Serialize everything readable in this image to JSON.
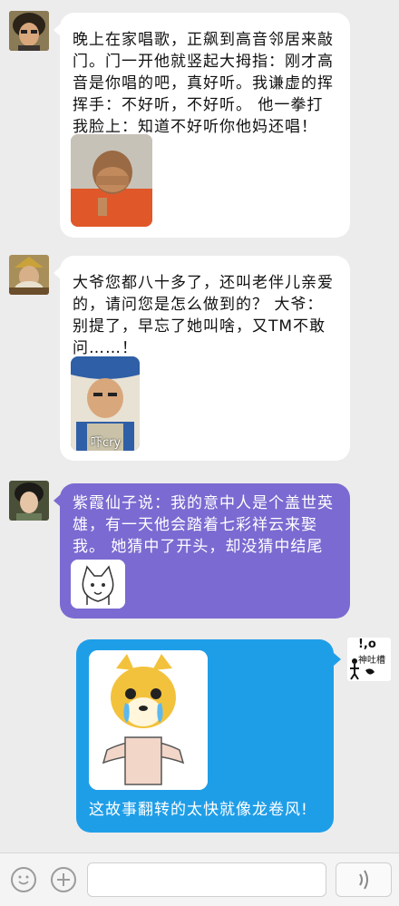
{
  "messages": [
    {
      "text": "晚上在家唱歌，正飙到高音邻居来敲门。门一开他就竖起大拇指：刚才高音是你唱的吧，真好听。我谦虚的挥挥手：不好听，不好听。 他一拳打我脸上：知道不好听你他妈还唱！"
    },
    {
      "text": "大爷您都八十多了，还叫老伴儿亲爱的，请问您是怎么做到的？ 大爷：别提了，早忘了她叫啥，又TM不敢问……！",
      "sticker_caption": "吓cry"
    },
    {
      "text": "紫霞仙子说：我的意中人是个盖世英雄，有一天他会踏着七彩祥云来娶我。 她猜中了开头，却没猜中结尾"
    },
    {
      "text": "这故事翻转的太快就像龙卷风!",
      "avatar_caption": "神吐槽",
      "avatar_mark": "!,o"
    }
  ],
  "colors": {
    "white_bubble": "#ffffff",
    "purple_bubble": "#7b6ad1",
    "blue_bubble": "#1f9ee8",
    "background": "#ececec"
  }
}
